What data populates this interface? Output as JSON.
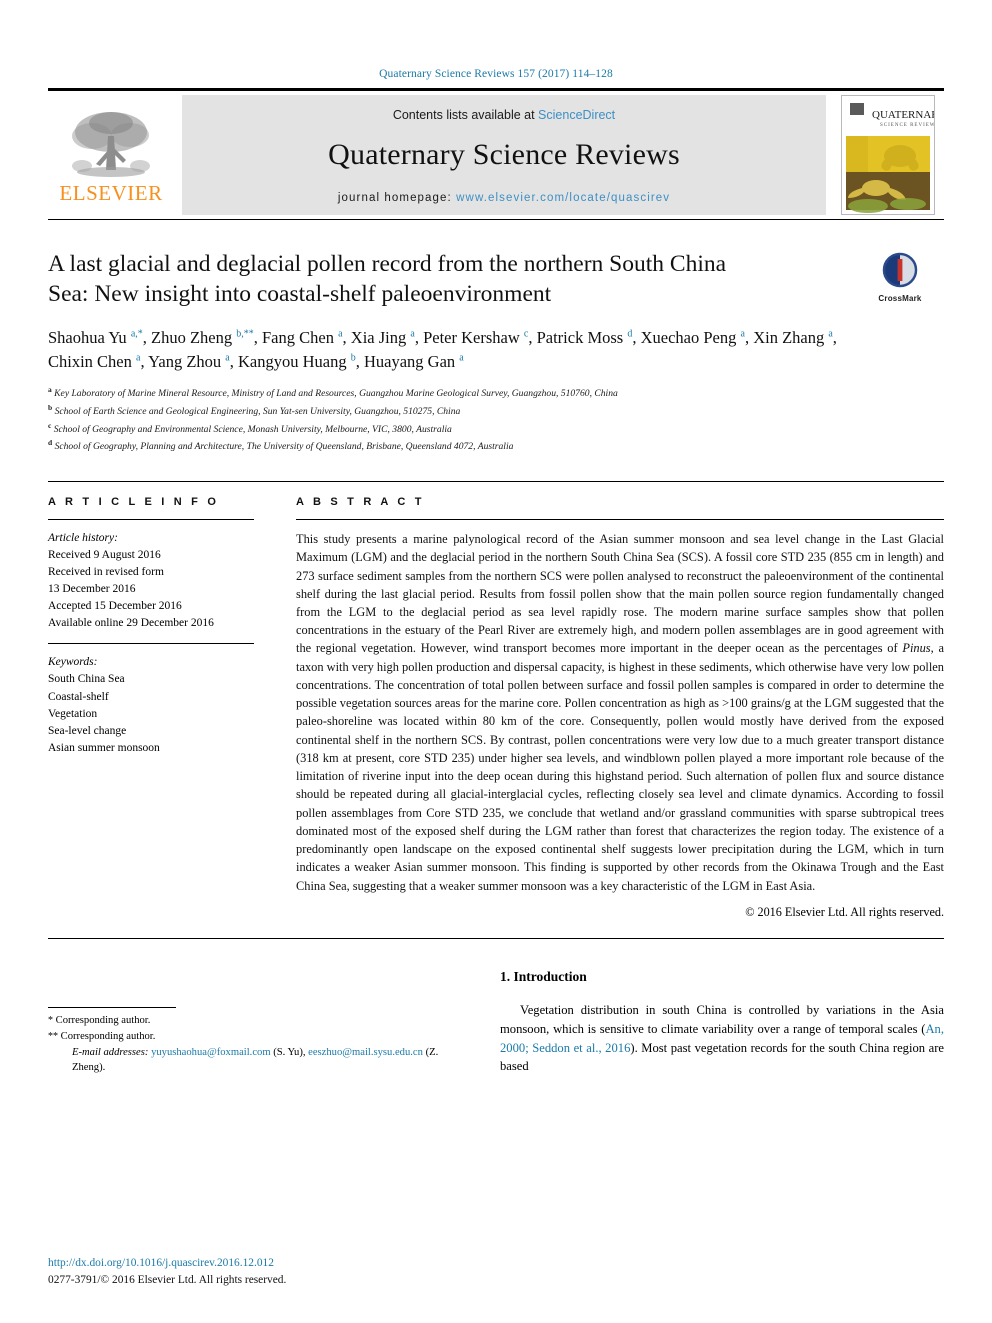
{
  "running_head": "Quaternary Science Reviews 157 (2017) 114–128",
  "masthead": {
    "publisher_logo_text": "ELSEVIER",
    "contents_prefix": "Contents lists available at ",
    "contents_link": "ScienceDirect",
    "journal_title": "Quaternary Science Reviews",
    "homepage_prefix": "journal homepage: ",
    "homepage_url": "www.elsevier.com/locate/quascirev",
    "cover_title": "QUATERNARY",
    "cover_subtitle": "SCIENCE REVIEWS"
  },
  "article": {
    "title": "A last glacial and deglacial pollen record from the northern South China Sea: New insight into coastal-shelf paleoenvironment",
    "crossmark_label": "CrossMark",
    "authors": [
      {
        "name": "Shaohua Yu",
        "marks": "a,*"
      },
      {
        "name": "Zhuo Zheng",
        "marks": "b,**"
      },
      {
        "name": "Fang Chen",
        "marks": "a"
      },
      {
        "name": "Xia Jing",
        "marks": "a"
      },
      {
        "name": "Peter Kershaw",
        "marks": "c"
      },
      {
        "name": "Patrick Moss",
        "marks": "d"
      },
      {
        "name": "Xuechao Peng",
        "marks": "a"
      },
      {
        "name": "Xin Zhang",
        "marks": "a"
      },
      {
        "name": "Chixin Chen",
        "marks": "a"
      },
      {
        "name": "Yang Zhou",
        "marks": "a"
      },
      {
        "name": "Kangyou Huang",
        "marks": "b"
      },
      {
        "name": "Huayang Gan",
        "marks": "a"
      }
    ],
    "affiliations": [
      {
        "marker": "a",
        "text": "Key Laboratory of Marine Mineral Resource, Ministry of Land and Resources, Guangzhou Marine Geological Survey, Guangzhou, 510760, China"
      },
      {
        "marker": "b",
        "text": "School of Earth Science and Geological Engineering, Sun Yat-sen University, Guangzhou, 510275, China"
      },
      {
        "marker": "c",
        "text": "School of Geography and Environmental Science, Monash University, Melbourne, VIC, 3800, Australia"
      },
      {
        "marker": "d",
        "text": "School of Geography, Planning and Architecture, The University of Queensland, Brisbane, Queensland 4072, Australia"
      }
    ]
  },
  "article_info": {
    "heading": "A R T I C L E  I N F O",
    "history_label": "Article history:",
    "history_lines": [
      "Received 9 August 2016",
      "Received in revised form",
      "13 December 2016",
      "Accepted 15 December 2016",
      "Available online 29 December 2016"
    ],
    "keywords_label": "Keywords:",
    "keywords": [
      "South China Sea",
      "Coastal-shelf",
      "Vegetation",
      "Sea-level change",
      "Asian summer monsoon"
    ]
  },
  "abstract": {
    "heading": "A B S T R A C T",
    "part1": "This study presents a marine palynological record of the Asian summer monsoon and sea level change in the Last Glacial Maximum (LGM) and the deglacial period in the northern South China Sea (SCS). A fossil core STD 235 (855 cm in length) and 273 surface sediment samples from the northern SCS were pollen analysed to reconstruct the paleoenvironment of the continental shelf during the last glacial period. Results from fossil pollen show that the main pollen source region fundamentally changed from the LGM to the deglacial period as sea level rapidly rose. The modern marine surface samples show that pollen concentrations in the estuary of the Pearl River are extremely high, and modern pollen assemblages are in good agreement with the regional vegetation. However, wind transport becomes more important in the deeper ocean as the percentages of ",
    "italic1": "Pinus",
    "part2": ", a taxon with very high pollen production and dispersal capacity, is highest in these sediments, which otherwise have very low pollen concentrations. The concentration of total pollen between surface and fossil pollen samples is compared in order to determine the possible vegetation sources areas for the marine core. Pollen concentration as high as >100 grains/g at the LGM suggested that the paleo-shoreline was located within 80 km of the core. Consequently, pollen would mostly have derived from the exposed continental shelf in the northern SCS. By contrast, pollen concentrations were very low due to a much greater transport distance (318 km at present, core STD 235) under higher sea levels, and windblown pollen played a more important role because of the limitation of riverine input into the deep ocean during this highstand period. Such alternation of pollen flux and source distance should be repeated during all glacial-interglacial cycles, reflecting closely sea level and climate dynamics. According to fossil pollen assemblages from Core STD 235, we conclude that wetland and/or grassland communities with sparse subtropical trees dominated most of the exposed shelf during the LGM rather than forest that characterizes the region today. The existence of a predominantly open landscape on the exposed continental shelf suggests lower precipitation during the LGM, which in turn indicates a weaker Asian summer monsoon. This finding is supported by other records from the Okinawa Trough and the East China Sea, suggesting that a weaker summer monsoon was a key characteristic of the LGM in East Asia.",
    "copyright": "© 2016 Elsevier Ltd. All rights reserved."
  },
  "introduction": {
    "heading": "1. Introduction",
    "para_pre": "Vegetation distribution in south China is controlled by variations in the Asia monsoon, which is sensitive to climate variability over a range of temporal scales (",
    "citation": "An, 2000; Seddon et al., 2016",
    "para_post": "). Most past vegetation records for the south China region are based"
  },
  "footnotes": {
    "line1_mark": "*",
    "line1_text": "Corresponding author.",
    "line2_mark": "**",
    "line2_text": "Corresponding author.",
    "email_label": "E-mail addresses:",
    "email1": "yuyushaohua@foxmail.com",
    "email1_person": "(S. Yu)",
    "email2": "eeszhuo@mail.sysu.edu.cn",
    "email2_person": "(Z. Zheng)."
  },
  "footer": {
    "doi": "http://dx.doi.org/10.1016/j.quascirev.2016.12.012",
    "issn": "0277-3791/© 2016 Elsevier Ltd. All rights reserved."
  },
  "colors": {
    "link": "#1a7aa8",
    "elsevier_orange": "#f7901e",
    "masthead_gray": "#e3e3e3",
    "sciencedirect_blue": "#3d8fc4"
  }
}
